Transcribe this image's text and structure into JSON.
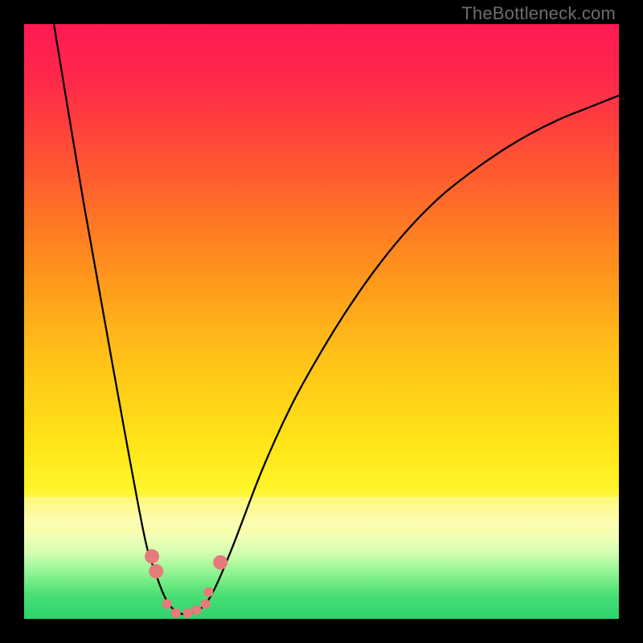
{
  "watermark": "TheBottleneck.com",
  "chart_data": {
    "type": "line",
    "title": "",
    "xlabel": "",
    "ylabel": "",
    "xlim": [
      0,
      100
    ],
    "ylim": [
      0,
      100
    ],
    "series": [
      {
        "name": "bottleneck-curve",
        "x": [
          5,
          10,
          15,
          20,
          22,
          24,
          26,
          28,
          30,
          32,
          35,
          40,
          45,
          50,
          55,
          60,
          65,
          70,
          75,
          80,
          85,
          90,
          95,
          100
        ],
        "values": [
          100,
          70,
          42,
          15,
          8,
          3,
          1,
          1,
          2,
          5,
          12,
          25,
          36,
          45,
          53,
          60,
          66,
          71,
          75,
          78.5,
          81.5,
          84,
          86,
          88
        ]
      }
    ],
    "markers": {
      "name": "highlight-dots",
      "color": "#e77a7a",
      "radius_small": 6,
      "radius_large": 9,
      "points_xy": [
        [
          21.5,
          10.5
        ],
        [
          22.2,
          8.0
        ],
        [
          24.0,
          2.5
        ],
        [
          25.5,
          1.0
        ],
        [
          27.5,
          1.0
        ],
        [
          29.0,
          1.5
        ],
        [
          30.5,
          2.5
        ],
        [
          31.0,
          4.5
        ],
        [
          33.0,
          9.5
        ]
      ]
    },
    "gradient_stops": [
      {
        "offset": 0.0,
        "color": "#ff1954"
      },
      {
        "offset": 0.1,
        "color": "#ff2a4a"
      },
      {
        "offset": 0.25,
        "color": "#ff5a2f"
      },
      {
        "offset": 0.4,
        "color": "#ff8e1d"
      },
      {
        "offset": 0.55,
        "color": "#ffbf18"
      },
      {
        "offset": 0.7,
        "color": "#ffe317"
      },
      {
        "offset": 0.78,
        "color": "#fff428"
      },
      {
        "offset": 0.83,
        "color": "#fffb8a"
      },
      {
        "offset": 0.86,
        "color": "#f4ffb8"
      },
      {
        "offset": 0.89,
        "color": "#d1ffb0"
      },
      {
        "offset": 0.92,
        "color": "#93f593"
      },
      {
        "offset": 0.96,
        "color": "#4adf74"
      },
      {
        "offset": 1.0,
        "color": "#2bd36c"
      }
    ],
    "band_top_fraction": 0.795
  }
}
